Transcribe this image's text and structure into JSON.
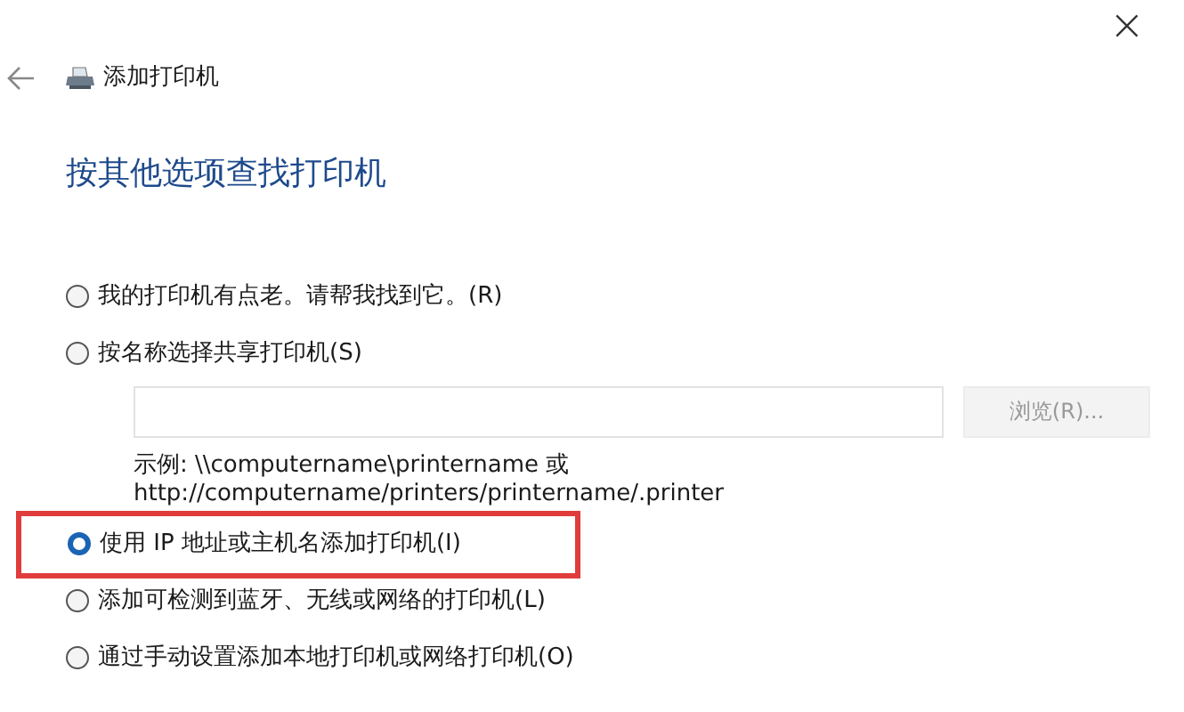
{
  "window": {
    "title": "添加打印机",
    "close": "×"
  },
  "heading": "按其他选项查找打印机",
  "options": [
    {
      "kind": "radio",
      "label": "我的打印机有点老。请帮我找到它。(R)",
      "selected": false,
      "highlighted": false
    },
    {
      "kind": "share",
      "label": "按名称选择共享打印机(S)",
      "selected": false,
      "button": {
        "label": "浏览(R)...",
        "disabled": true
      },
      "hint_lines": [
        "示例: \\\\computername\\printername 或",
        "http://computername/printers/printername/.printer"
      ]
    },
    {
      "kind": "radio",
      "label": "使用 IP 地址或主机名添加打印机(I)",
      "selected": true,
      "highlighted": true
    },
    {
      "kind": "radio",
      "label": "添加可检测到蓝牙、无线或网络的打印机(L)",
      "selected": false,
      "highlighted": false
    },
    {
      "kind": "radio",
      "label": "通过手动设置添加本地打印机或网络打印机(O)",
      "selected": false,
      "highlighted": false
    }
  ]
}
